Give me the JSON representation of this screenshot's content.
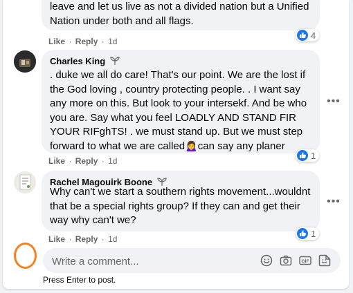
{
  "comments": [
    {
      "text": "leave and let us live as not a divided nation but a Unified Nation under both and all flags.",
      "like_label": "Like",
      "reply_label": "Reply",
      "separator": "·",
      "timestamp": "1d",
      "reaction_count": "4"
    },
    {
      "author": "Charles King",
      "text": ". duke we all do care! That's our point. We are the lost if the God loving , country protecting people. . I want say any more on this. But look to your intersekf. And be who you are. Say what you feel LOADLY AND STAND FIR YOUR RIFghTS! . we must stand up. But we must step forward to what we are called",
      "text_end": "can say any planer",
      "emoji": "🙍‍♀️",
      "like_label": "Like",
      "reply_label": "Reply",
      "separator": "·",
      "timestamp": "1d",
      "reaction_count": "1"
    },
    {
      "author": "Rachel Magouirk Boone",
      "text": "Why can't we start a southern rights movement...wouldnt that be a special rights group? If they can and get their way why can't we?",
      "like_label": "Like",
      "reply_label": "Reply",
      "separator": "·",
      "timestamp": "1d",
      "reaction_count": "1"
    }
  ],
  "composer": {
    "placeholder": "Write a comment...",
    "hint": "Press Enter to post."
  },
  "colors": {
    "reaction_blue": "#1877f2",
    "bubble_bg": "#f0f2f5",
    "highlight_ring": "#f5821f"
  },
  "icons": {
    "like": "like-icon",
    "more": "more-options-icon",
    "emoji": "emoji-icon",
    "camera": "camera-icon",
    "gif": "gif-icon",
    "sticker": "sticker-icon",
    "badge": "sprout-badge-icon"
  }
}
